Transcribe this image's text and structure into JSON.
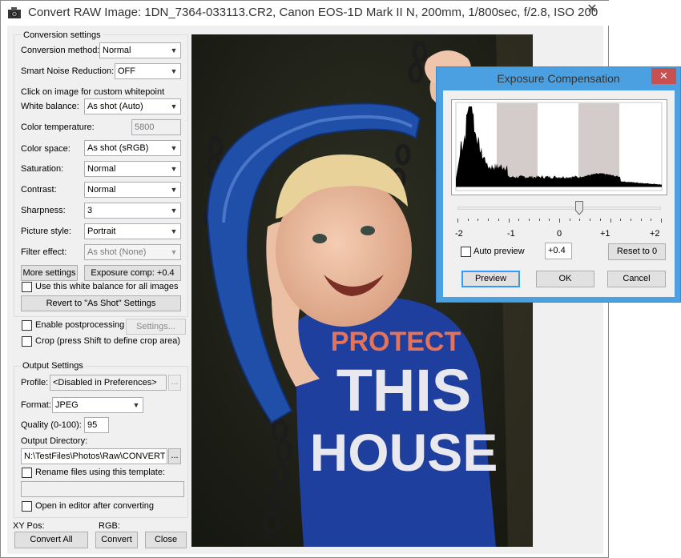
{
  "window": {
    "title": "Convert RAW Image: 1DN_7364-033113.CR2, Canon EOS-1D Mark II N, 200mm, 1/800sec, f/2.8, ISO 200",
    "close_glyph": "✕"
  },
  "conversion": {
    "group_label": "Conversion settings",
    "method_label": "Conversion method:",
    "method_value": "Normal",
    "noise_label": "Smart Noise Reduction:",
    "noise_value": "OFF",
    "whitepoint_hint": "Click on image for custom whitepoint",
    "wb_label": "White balance:",
    "wb_value": "As shot (Auto)",
    "temp_label": "Color temperature:",
    "temp_value": "5800",
    "colorspace_label": "Color space:",
    "colorspace_value": "As shot (sRGB)",
    "saturation_label": "Saturation:",
    "saturation_value": "Normal",
    "contrast_label": "Contrast:",
    "contrast_value": "Normal",
    "sharpness_label": "Sharpness:",
    "sharpness_value": "3",
    "style_label": "Picture style:",
    "style_value": "Portrait",
    "filter_label": "Filter effect:",
    "filter_value": "As shot (None)",
    "more_settings": "More settings",
    "exposure_comp": "Exposure comp: +0.4",
    "use_wb_all": "Use this white balance for all images",
    "revert": "Revert to \"As Shot\" Settings"
  },
  "post": {
    "enable_label": "Enable postprocessing",
    "settings_button": "Settings...",
    "crop_label": "Crop (press Shift to define crop area)"
  },
  "output": {
    "group_label": "Output Settings",
    "profile_label": "Profile:",
    "profile_value": "<Disabled in Preferences>",
    "ellipsis": "...",
    "format_label": "Format:",
    "format_value": "JPEG",
    "quality_label": "Quality (0-100):",
    "quality_value": "95",
    "dir_label": "Output Directory:",
    "dir_value": "N:\\TestFiles\\Photos\\Raw\\CONVERT",
    "rename_label": "Rename files using this template:",
    "open_editor_label": "Open in editor after converting"
  },
  "footer": {
    "xy_label": "XY Pos:",
    "rgb_label": "RGB:",
    "convert_all": "Convert All",
    "convert": "Convert",
    "close": "Close"
  },
  "exposure_dialog": {
    "title": "Exposure Compensation",
    "close_glyph": "✕",
    "tick_labels": [
      "-2",
      "-1",
      "0",
      "+1",
      "+2"
    ],
    "slider_value": 0.4,
    "slider_min": -2,
    "slider_max": 2,
    "auto_preview_label": "Auto preview",
    "value": "+0.4",
    "reset_button": "Reset to 0",
    "preview_button": "Preview",
    "ok_button": "OK",
    "cancel_button": "Cancel"
  },
  "photo": {
    "shirt_text_1": "PROTECT",
    "shirt_text_2": "THIS",
    "shirt_text_3": "HOUSE"
  },
  "colors": {
    "dialog_frame": "#4aa0e0",
    "close_red": "#c75050",
    "swing_blue": "#1f4fa8",
    "shirt_blue": "#1e3f9e"
  }
}
